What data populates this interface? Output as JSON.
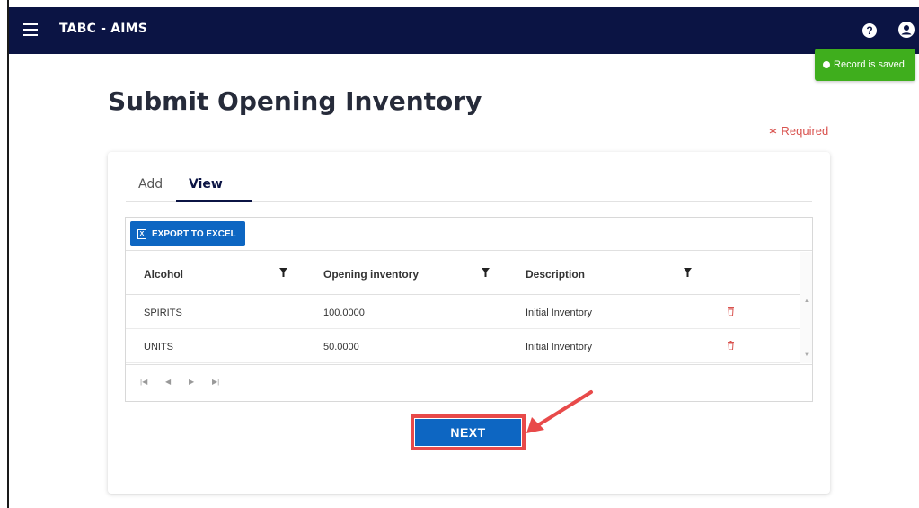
{
  "app": {
    "title": "TABC - AIMS"
  },
  "toast": {
    "text": "Record is saved."
  },
  "page": {
    "title": "Submit Opening Inventory",
    "required_label": "∗ Required"
  },
  "tabs": [
    {
      "label": "Add",
      "active": false
    },
    {
      "label": "View",
      "active": true
    }
  ],
  "grid": {
    "export_label": "EXPORT TO EXCEL",
    "columns": [
      "Alcohol",
      "Opening inventory",
      "Description"
    ],
    "rows": [
      {
        "alcohol": "SPIRITS",
        "opening_inventory": "100.0000",
        "description": "Initial Inventory"
      },
      {
        "alcohol": "UNITS",
        "opening_inventory": "50.0000",
        "description": "Initial Inventory"
      }
    ]
  },
  "actions": {
    "next_label": "NEXT"
  },
  "colors": {
    "navbar": "#0b1444",
    "primary": "#0d66c2",
    "success": "#3fae1d",
    "highlight": "#e84a4a",
    "delete": "#d9534f"
  }
}
